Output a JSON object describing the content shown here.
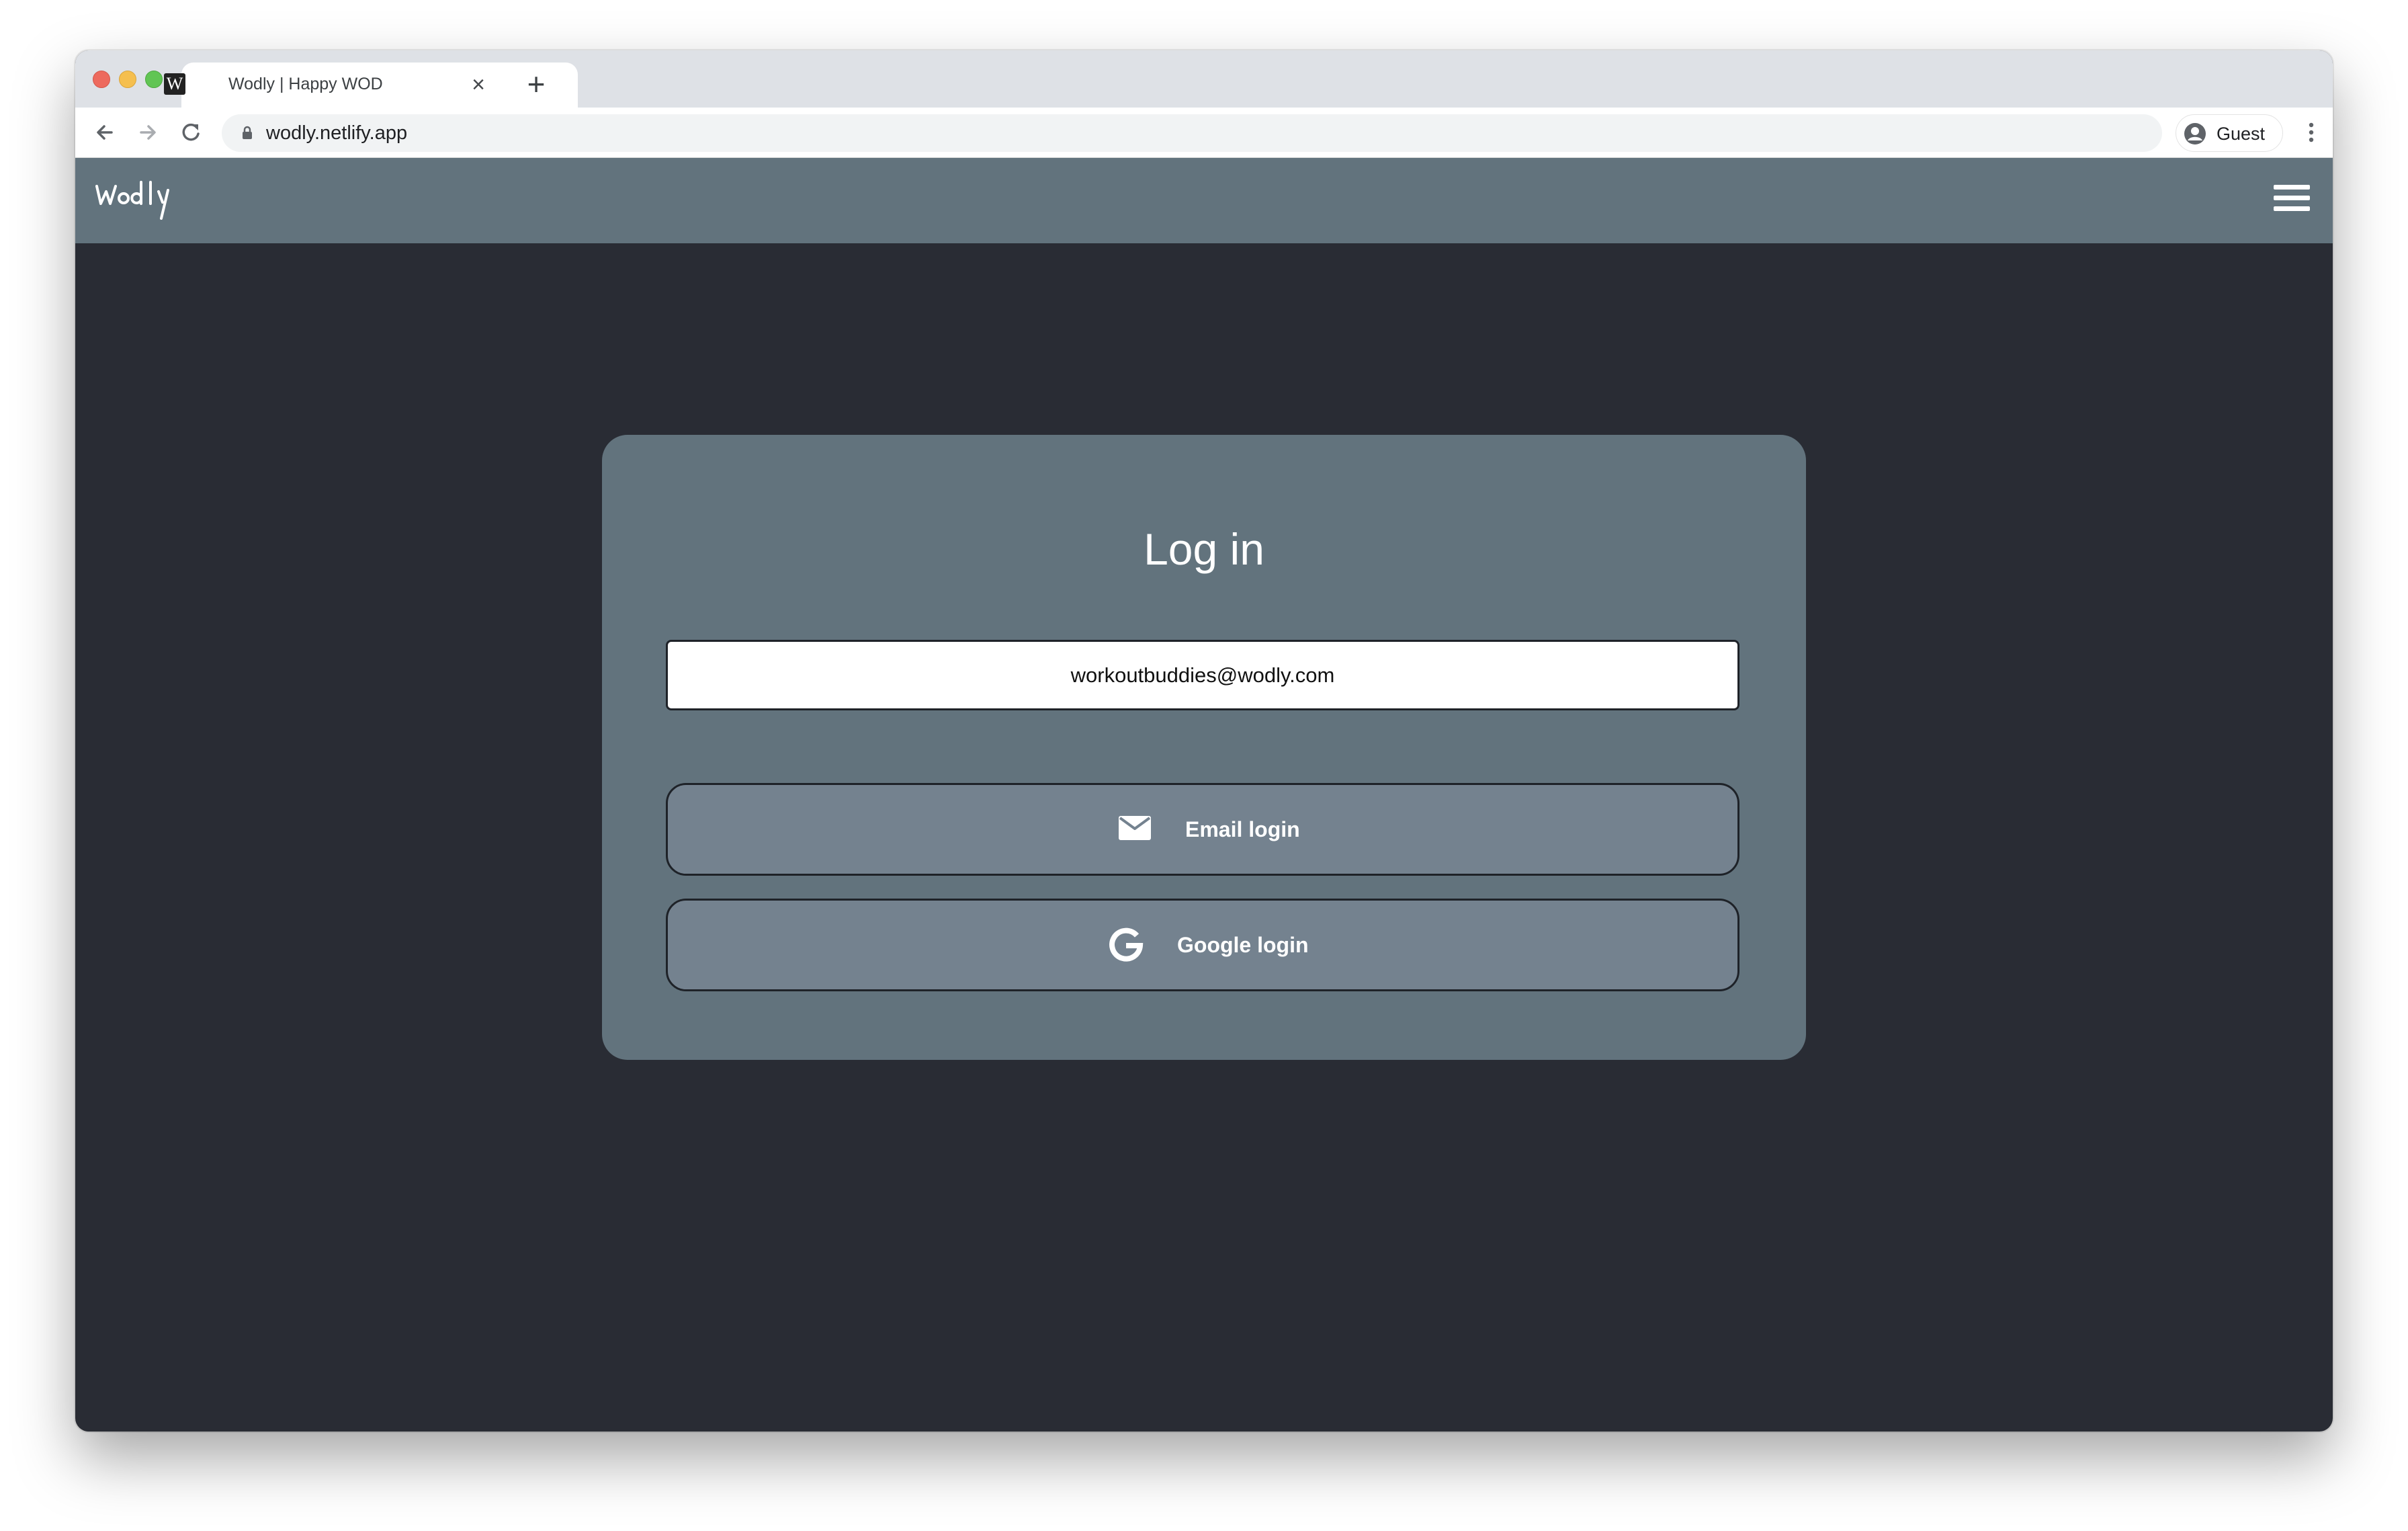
{
  "browser": {
    "tab": {
      "favicon_letter": "W",
      "title": "Wodly | Happy WOD",
      "close_glyph": "×"
    },
    "new_tab_glyph": "+",
    "address_bar": {
      "url": "wodly.netlify.app"
    },
    "profile": {
      "label": "Guest"
    },
    "icons": {
      "back": "arrow-left-icon",
      "forward": "arrow-right-icon",
      "reload": "reload-icon",
      "lock": "lock-icon",
      "profile": "person-circle-icon",
      "menu": "vertical-dots-icon"
    }
  },
  "app": {
    "logo_icon": "wodly-logo",
    "menu_icon": "hamburger-icon",
    "colors": {
      "header": "#62737d",
      "background": "#292c34",
      "card": "#62737d",
      "button": "#74828f"
    }
  },
  "login": {
    "title": "Log in",
    "email_value": "workoutbuddies@wodly.com",
    "email_button": {
      "label": "Email login",
      "icon": "envelope-icon"
    },
    "google_button": {
      "label": "Google login",
      "icon": "google-g-icon"
    }
  }
}
